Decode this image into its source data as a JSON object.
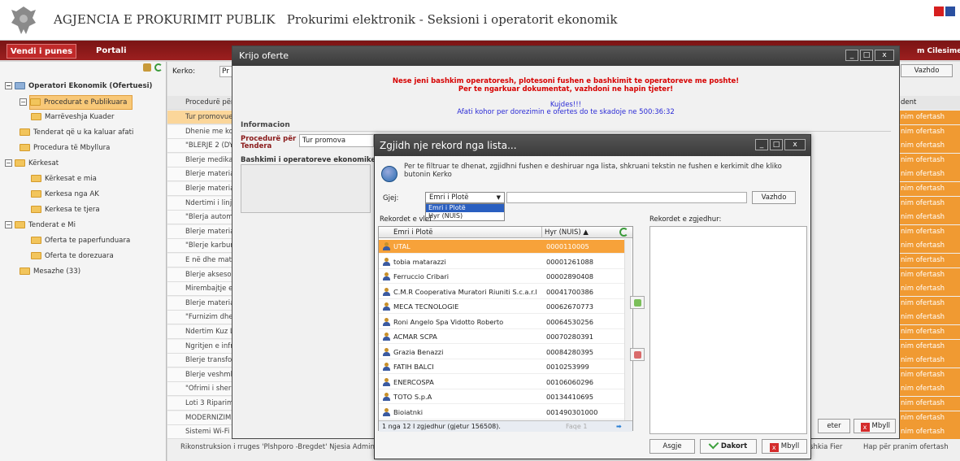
{
  "header": {
    "agency": "AGJENCIA E PROKURIMIT PUBLIK",
    "subtitle": "Prokurimi elektronik - Seksioni i operatorit ekonomik"
  },
  "nav": {
    "tab_active": "Vendi i punes",
    "tab_portal": "Portali",
    "right_partial": "m Cilesimet"
  },
  "sidebar": {
    "root": "Operatori Ekonomik (Ofertuesi)",
    "items": [
      "Procedurat e Publikuara",
      "Marrëveshja Kuader",
      "Tenderat që u ka kaluar afati",
      "Procedura të Mbyllura",
      "Kërkesat",
      "Kërkesat e mia",
      "Kerkesa nga AK",
      "Kerkesa te tjera",
      "Tenderat e Mi",
      "Oferta te paperfunduara",
      "Oferta te dorezuara",
      "Mesazhe (33)"
    ]
  },
  "main": {
    "search_label": "Kerko:",
    "search_partial": "Pr",
    "vazhdo": "Vazhdo",
    "col_header": "Procedurë për T",
    "col_right": "dent",
    "rows": [
      "Tur promovuese",
      "Dhenie me konc",
      "\"BLERJE 2 (DY)",
      "Blerje medikam",
      "Blerje materiale",
      "Blerje materiale",
      "Ndertimi i linjës",
      "\"Blerja automje",
      "Blerje materiale",
      "\"Blerje karburan",
      "E në dhe mater",
      "Blerje aksesore",
      "Mirembajtje e S",
      "Blerje materiale",
      "\"Furnizim dhe m",
      "Ndertim Kuz Lul",
      "Ngritjen e infra",
      "Blerje transforn",
      "Blerje veshmbal",
      "\"Ofrimi i sherbi",
      "Loti 3 Riparim-",
      "MODERNIZIMI",
      "Sistemi Wi-Fi pe"
    ],
    "right_cells": "nim ofertash",
    "bottom_row": "Rikonstruksion i rruges 'Plshporo -Bregdet' Njesia Administrative Levan",
    "bottom_status": "Hap për pranim ofertash",
    "bottom_basnik": "Bashkia Fier"
  },
  "dialog_offer": {
    "title": "Krijo oferte",
    "warning_line1": "Nese jeni bashkim operatoresh, plotesoni fushen e bashkimit te operatoreve me poshte!",
    "warning_line2": "Per te ngarkuar dokumentat, vazhdoni ne hapin tjeter!",
    "caution": "Kujdes!!!",
    "deadline": "Afati kohor per dorezimin e ofertes do te skadoje ne 500:36:32",
    "info_heading": "Informacion",
    "proc_label_1": "Procedurë për",
    "proc_label_2": "Tendera",
    "proc_value": "Tur promova",
    "bashkim_label": "Bashkimi i operatoreve ekonomike",
    "btn_next": "eter",
    "btn_close": "Mbyll"
  },
  "dialog_pick": {
    "title": "Zgjidh nje rekord nga lista...",
    "hint": "Per te filtruar te dhenat, zgjidhni fushen e deshiruar nga lista, shkruani tekstin ne fushen e kerkimit dhe kliko butonin Kerko",
    "find_label": "Gjej:",
    "select_value": "Emri i Plotë",
    "options": [
      "Emri i Plotë",
      "Hyr (NUIS)"
    ],
    "vazhdo": "Vazhdo",
    "left_label": "Rekordet e vlef",
    "right_label": "Rekordet e zgjedhur:",
    "col_name": "Emri i Plotë",
    "col_nuis": "Hyr (NUIS) ▲",
    "records": [
      {
        "name": "UTAL",
        "nuis": "0000110005"
      },
      {
        "name": "tobia matarazzi",
        "nuis": "00001261088"
      },
      {
        "name": "Ferruccio Cribari",
        "nuis": "00002890408"
      },
      {
        "name": "C.M.R Cooperativa Muratori Riuniti S.c.a.r.l",
        "nuis": "00041700386"
      },
      {
        "name": "MECA TECNOLOGIE",
        "nuis": "00062670773"
      },
      {
        "name": "Roni Angelo Spa Vidotto Roberto",
        "nuis": "00064530256"
      },
      {
        "name": "ACMAR SCPA",
        "nuis": "00070280391"
      },
      {
        "name": "Grazia Benazzi",
        "nuis": "00084280395"
      },
      {
        "name": "FATIH BALCI",
        "nuis": "0010253999"
      },
      {
        "name": "ENERCOSPA",
        "nuis": "00106060296"
      },
      {
        "name": "TOTO S.p.A",
        "nuis": "00134410695"
      },
      {
        "name": "Bioiatnki",
        "nuis": "001490301000"
      }
    ],
    "footer_text": "1 nga 12 I zgjedhur (gjetur 156508).",
    "footer_page": "Faqe 1",
    "btn_asgje": "Asgje",
    "btn_dakort": "Dakort",
    "btn_mbyll": "Mbyll"
  }
}
